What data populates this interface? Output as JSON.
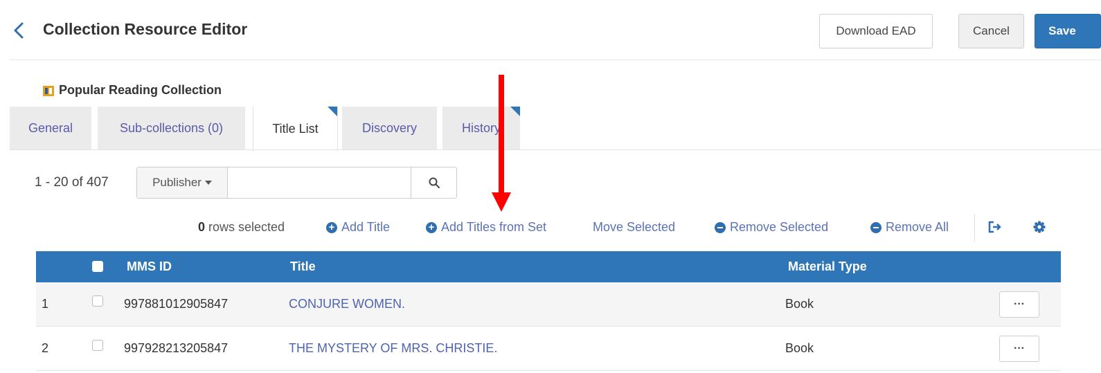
{
  "header": {
    "title": "Collection Resource Editor",
    "download_label": "Download EAD",
    "cancel_label": "Cancel",
    "save_label": "Save"
  },
  "record": {
    "title": "Popular Reading Collection"
  },
  "tabs": [
    {
      "label": "General"
    },
    {
      "label": "Sub-collections (0)"
    },
    {
      "label": "Title List",
      "active": true
    },
    {
      "label": "Discovery"
    },
    {
      "label": "History"
    }
  ],
  "search": {
    "result_count": "1 - 20 of 407",
    "scope": "Publisher",
    "value": "",
    "placeholder": ""
  },
  "toolbar": {
    "rows_selected_count": "0",
    "rows_selected_label": "rows selected",
    "add_title": "Add Title",
    "add_titles_from_set": "Add Titles from Set",
    "move_selected": "Move Selected",
    "remove_selected": "Remove Selected",
    "remove_all": "Remove All",
    "icons": [
      "export-icon",
      "gear-icon"
    ]
  },
  "table": {
    "columns": [
      "MMS ID",
      "Title",
      "Material Type"
    ],
    "rows": [
      {
        "index": "1",
        "mms_id": "997881012905847",
        "title": "CONJURE WOMEN.",
        "material_type": "Book",
        "more": "···"
      },
      {
        "index": "2",
        "mms_id": "997928213205847",
        "title": "THE MYSTERY OF MRS. CHRISTIE.",
        "material_type": "Book",
        "more": "···"
      }
    ]
  },
  "colors": {
    "accent": "#2f76b9",
    "link": "#4f63ae",
    "annotation_arrow": "#ff0000"
  }
}
